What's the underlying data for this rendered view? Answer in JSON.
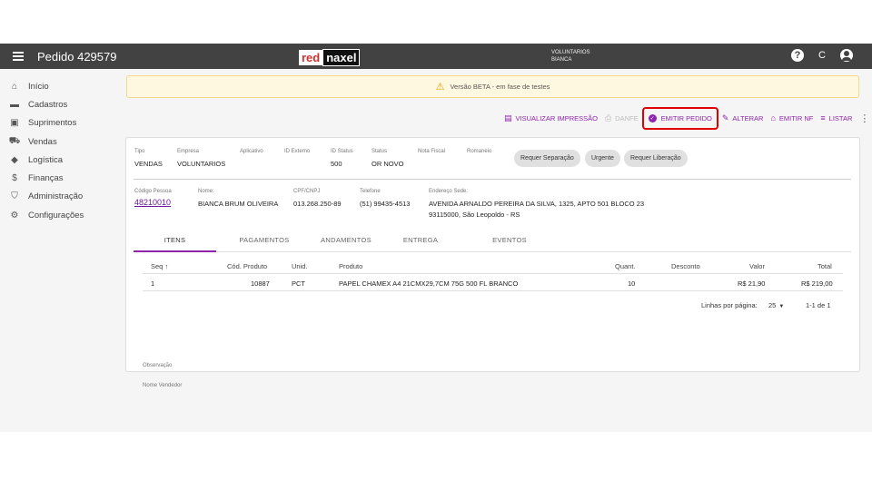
{
  "header": {
    "title": "Pedido 429579",
    "logo_red": "red",
    "logo_dark": "naxel",
    "user_line1": "VOLUNTARIOS",
    "user_line2": "BIANCA",
    "help_icon": "?",
    "refresh_icon": "C"
  },
  "sidebar": {
    "items": [
      {
        "label": "Início",
        "icon": "home-icon"
      },
      {
        "label": "Cadastros",
        "icon": "folder-icon"
      },
      {
        "label": "Suprimentos",
        "icon": "briefcase-icon"
      },
      {
        "label": "Vendas",
        "icon": "cart-icon"
      },
      {
        "label": "Logística",
        "icon": "diamond-icon"
      },
      {
        "label": "Finanças",
        "icon": "dollar-icon"
      },
      {
        "label": "Administração",
        "icon": "shield-icon"
      },
      {
        "label": "Configurações",
        "icon": "gear-icon"
      }
    ]
  },
  "banner": {
    "text": "Versão BETA - em fase de testes"
  },
  "actions": {
    "visualizar": "VISUALIZAR IMPRESSÃO",
    "danfe": "DANFE",
    "emitir_pedido": "EMITIR PEDIDO",
    "alterar": "ALTERAR",
    "emitir_nf": "EMITIR NF",
    "listar": "LISTAR"
  },
  "order": {
    "tipo_label": "Tipo",
    "tipo": "VENDAS",
    "empresa_label": "Empresa",
    "empresa": "VOLUNTARIOS",
    "aplicativo_label": "Aplicativo",
    "id_externo_label": "ID Externo",
    "id_status_label": "ID Status",
    "id_status": "500",
    "status_label": "Status",
    "status": "OR NOVO",
    "nota_fiscal_label": "Nota Fiscal",
    "romaneio_label": "Romaneio",
    "chips": [
      "Requer Separação",
      "Urgente",
      "Requer Liberação"
    ]
  },
  "person": {
    "codigo_label": "Código Pessoa",
    "codigo": "48210010",
    "nome_label": "Nome:",
    "nome": "BIANCA BRUM OLIVEIRA",
    "cpf_label": "CPF/CNPJ",
    "cpf": "013.268.250-89",
    "telefone_label": "Telefone",
    "telefone": "(51) 99435-4513",
    "endereco_label": "Endereço Sede:",
    "endereco1": "AVENIDA ARNALDO PEREIRA DA SILVA, 1325, APTO 501 BLOCO 23",
    "endereco2": "93115000, São Leopoldo - RS"
  },
  "tabs": [
    "ITENS",
    "PAGAMENTOS",
    "ANDAMENTOS",
    "ENTREGA",
    "EVENTOS"
  ],
  "table": {
    "headers": {
      "seq": "Seq",
      "sort_icon": "↑",
      "cod": "Cód. Produto",
      "unid": "Unid.",
      "produto": "Produto",
      "quant": "Quant.",
      "desconto": "Desconto",
      "valor": "Valor",
      "total": "Total"
    },
    "rows": [
      {
        "seq": "1",
        "cod": "10887",
        "unid": "PCT",
        "produto": "PAPEL CHAMEX A4 21CMX29,7CM 75G 500 FL BRANCO",
        "quant": "10",
        "desconto": "",
        "valor": "R$ 21,90",
        "total": "R$ 219,00"
      }
    ],
    "footer": {
      "rows_per_page_label": "Linhas por página:",
      "rows_per_page": "25",
      "range": "1-1 de 1"
    }
  },
  "extra": {
    "observacao": "Observação",
    "nome_vendedor": "Nome Vendedor"
  },
  "colors": {
    "accent": "#8e24aa",
    "highlight": "#e00000",
    "topbar": "#424242"
  }
}
